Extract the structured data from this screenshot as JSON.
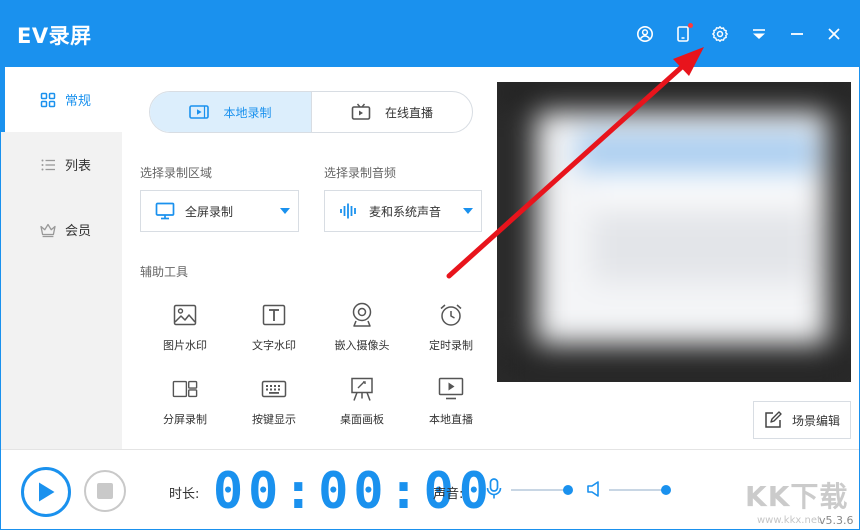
{
  "app": {
    "title": "EV录屏"
  },
  "titlebar": {
    "buttons": [
      "user-icon",
      "phone-notification-icon",
      "gear-icon",
      "dropdown-menu-icon",
      "minimize-icon",
      "close-icon"
    ]
  },
  "sidebar": {
    "items": [
      {
        "label": "常规",
        "icon": "grid-icon",
        "active": true
      },
      {
        "label": "列表",
        "icon": "list-icon",
        "active": false
      },
      {
        "label": "会员",
        "icon": "crown-icon",
        "active": false
      }
    ]
  },
  "mode_tabs": [
    {
      "label": "本地录制",
      "icon": "video-play-icon",
      "active": true
    },
    {
      "label": "在线直播",
      "icon": "tv-icon",
      "active": false
    }
  ],
  "record_area": {
    "label": "选择录制区域",
    "value": "全屏录制",
    "icon": "monitor-icon"
  },
  "record_audio": {
    "label": "选择录制音频",
    "value": "麦和系统声音",
    "icon": "waveform-icon"
  },
  "tools": {
    "label": "辅助工具",
    "items": [
      {
        "label": "图片水印",
        "icon": "image-icon"
      },
      {
        "label": "文字水印",
        "icon": "text-icon"
      },
      {
        "label": "嵌入摄像头",
        "icon": "webcam-icon"
      },
      {
        "label": "定时录制",
        "icon": "alarm-clock-icon"
      },
      {
        "label": "分屏录制",
        "icon": "split-screen-icon"
      },
      {
        "label": "按键显示",
        "icon": "keyboard-icon"
      },
      {
        "label": "桌面画板",
        "icon": "easel-icon"
      },
      {
        "label": "本地直播",
        "icon": "screen-play-icon"
      }
    ]
  },
  "scene_button": {
    "label": "场景编辑",
    "icon": "edit-icon"
  },
  "bottom": {
    "duration_label": "时长:",
    "timer": "00:00:00",
    "volume_label": "声音:",
    "mic_level": 0.95,
    "speaker_level": 0.95,
    "version": "v5.3.6"
  },
  "watermark": {
    "text": "KK下载",
    "url": "www.kkx.net"
  },
  "colors": {
    "accent": "#1a91ee",
    "annotation": "#e8141c",
    "sidebar_bg": "#f2f2f2"
  }
}
